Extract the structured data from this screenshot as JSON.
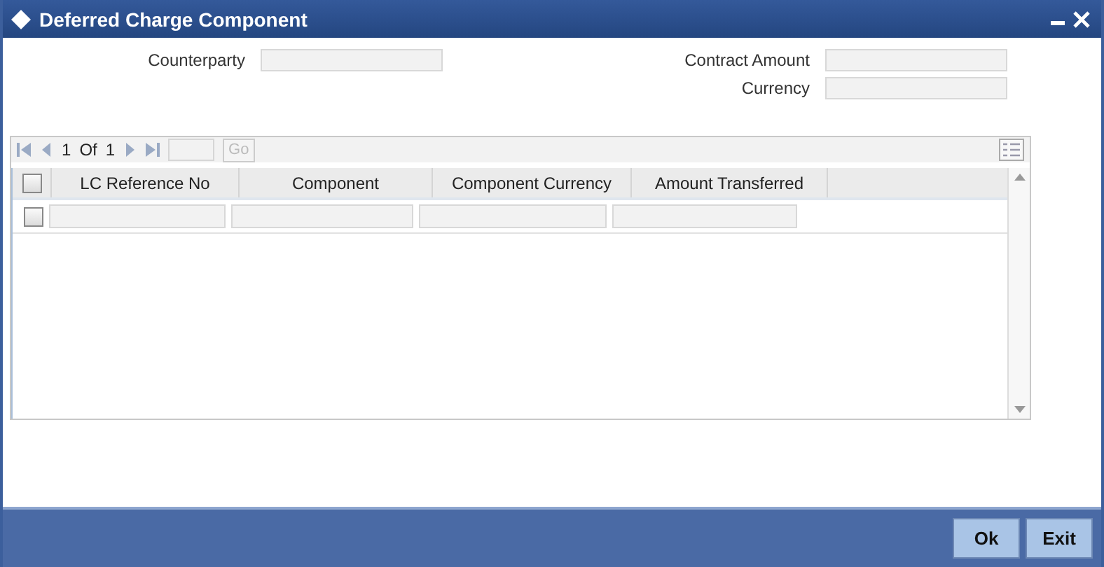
{
  "window": {
    "title": "Deferred Charge Component"
  },
  "fields": [
    {
      "label": "Counterparty"
    },
    {
      "label": "Contract Amount"
    },
    {
      "label": "Currency"
    }
  ],
  "pager": {
    "current": "1",
    "of": "Of",
    "total": "1",
    "go": "Go"
  },
  "table": {
    "select_all_checked": false,
    "columns": [
      "LC Reference No",
      "Component",
      "Component Currency",
      "Amount Transferred"
    ],
    "rows": [
      {
        "checked": false
      }
    ]
  },
  "buttons": [
    "Ok",
    "Exit"
  ]
}
